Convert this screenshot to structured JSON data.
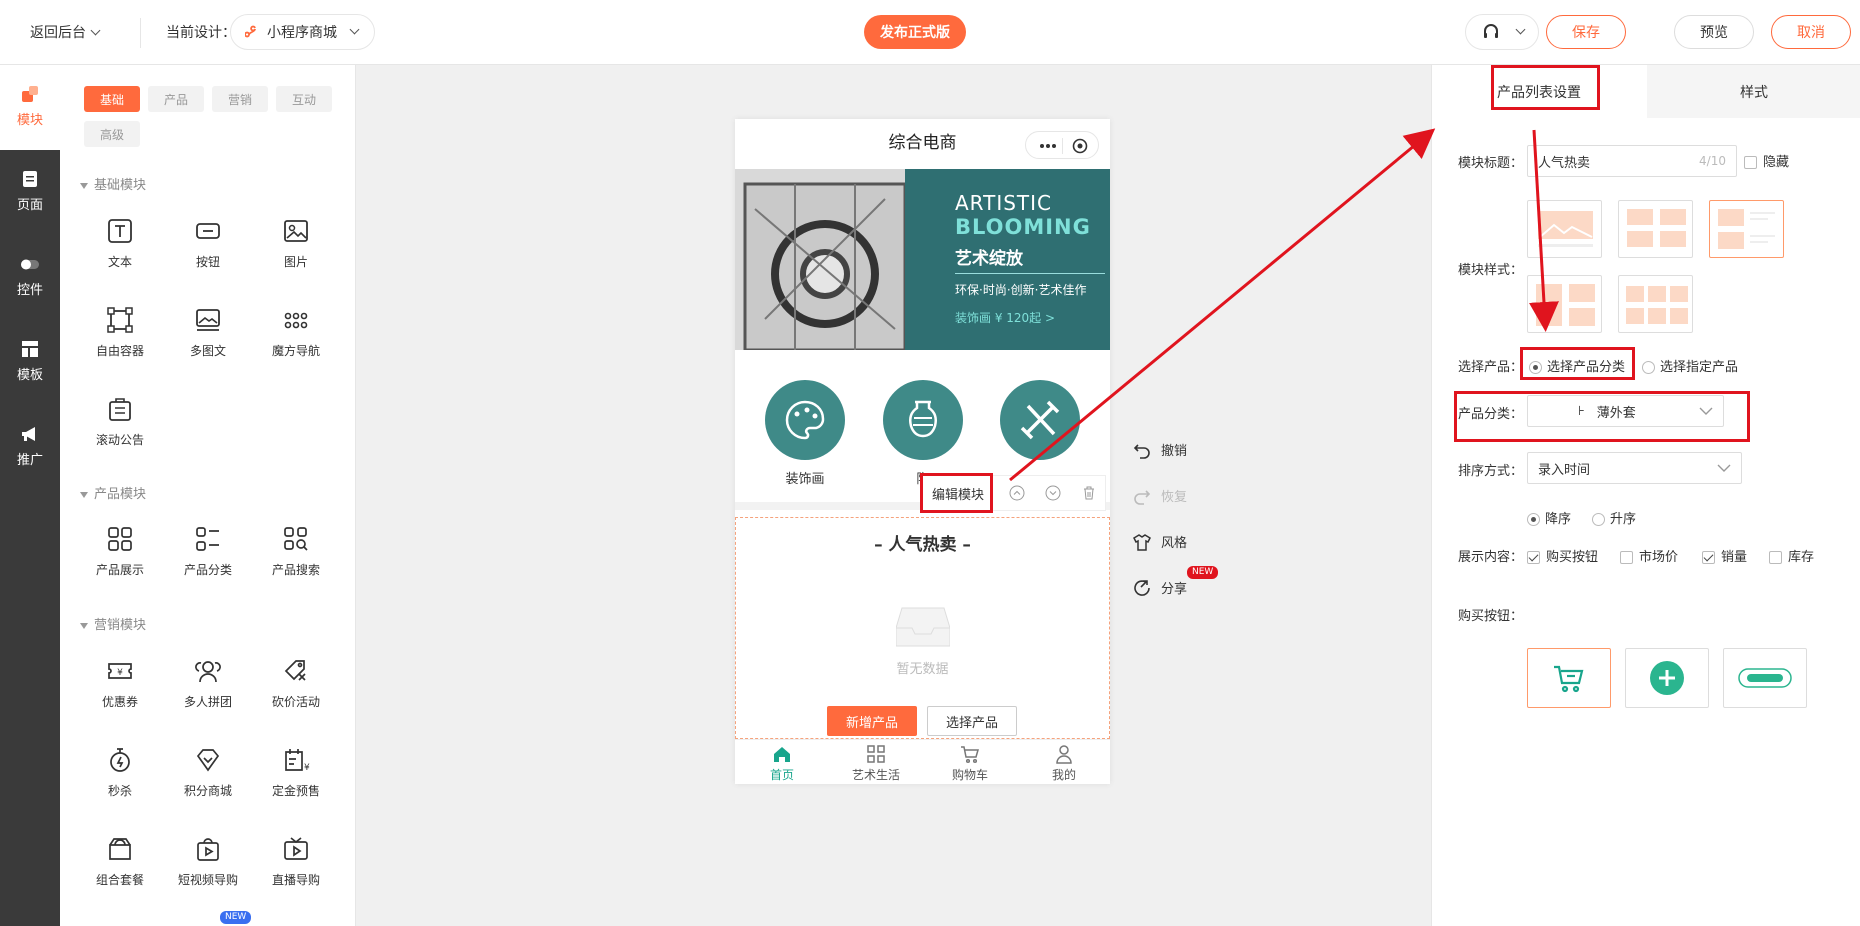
{
  "topbar": {
    "back_label": "返回后台",
    "current_design_label": "当前设计：",
    "design_name": "小程序商城",
    "publish_label": "发布正式版",
    "save_label": "保存",
    "preview_label": "预览",
    "cancel_label": "取消"
  },
  "leftnav": {
    "items": [
      {
        "label": "模块",
        "icon": "modules-icon"
      },
      {
        "label": "页面",
        "icon": "page-icon"
      },
      {
        "label": "控件",
        "icon": "toggle-icon"
      },
      {
        "label": "模板",
        "icon": "template-icon"
      },
      {
        "label": "推广",
        "icon": "megaphone-icon"
      }
    ]
  },
  "palette": {
    "tags": [
      "基础",
      "产品",
      "营销",
      "互动",
      "高级"
    ],
    "sections": {
      "basic": "基础模块",
      "product": "产品模块",
      "marketing": "营销模块"
    },
    "basic_items": [
      "文本",
      "按钮",
      "图片",
      "自由容器",
      "多图文",
      "魔方导航",
      "滚动公告"
    ],
    "product_items": [
      "产品展示",
      "产品分类",
      "产品搜索"
    ],
    "marketing_items": [
      "优惠券",
      "多人拼团",
      "砍价活动",
      "秒杀",
      "积分商城",
      "定金预售",
      "组合套餐",
      "短视频导购",
      "直播导购"
    ],
    "new_badge": "NEW"
  },
  "phone": {
    "title": "综合电商",
    "banner": {
      "line1": "ARTISTIC",
      "line2": "BLOOMING",
      "line3": "艺术绽放",
      "line4": "环保·时尚·创新·艺术佳作",
      "line5": "装饰画 ¥ 120起 >"
    },
    "categories": [
      "装饰画",
      "陶",
      ""
    ],
    "edit_module_label": "编辑模块",
    "hot_title": "人气热卖",
    "empty_text": "暂无数据",
    "add_product_label": "新增产品",
    "select_product_label": "选择产品",
    "tabs": [
      "首页",
      "艺术生活",
      "购物车",
      "我的"
    ]
  },
  "actions": {
    "undo": "撤销",
    "redo": "恢复",
    "style": "风格",
    "share": "分享",
    "share_badge": "NEW"
  },
  "rpanel": {
    "tab_settings": "产品列表设置",
    "tab_style": "样式",
    "module_title_label": "模块标题：",
    "module_title_value": "人气热卖",
    "module_title_count": "4/10",
    "hide_label": "隐藏",
    "module_style_label": "模块样式：",
    "select_product_label": "选择产品：",
    "select_by_category": "选择产品分类",
    "select_specific": "选择指定产品",
    "category_label": "产品分类：",
    "category_value": "薄外套",
    "sort_label": "排序方式：",
    "sort_value": "录入时间",
    "order_desc": "降序",
    "order_asc": "升序",
    "display_label": "展示内容：",
    "display_buy": "购买按钮",
    "display_market": "市场价",
    "display_sales": "销量",
    "display_stock": "库存",
    "buy_button_label": "购买按钮："
  },
  "colors": {
    "accent": "#ff6a3d",
    "teal": "#3f8a88",
    "annotation": "#e0141e"
  }
}
